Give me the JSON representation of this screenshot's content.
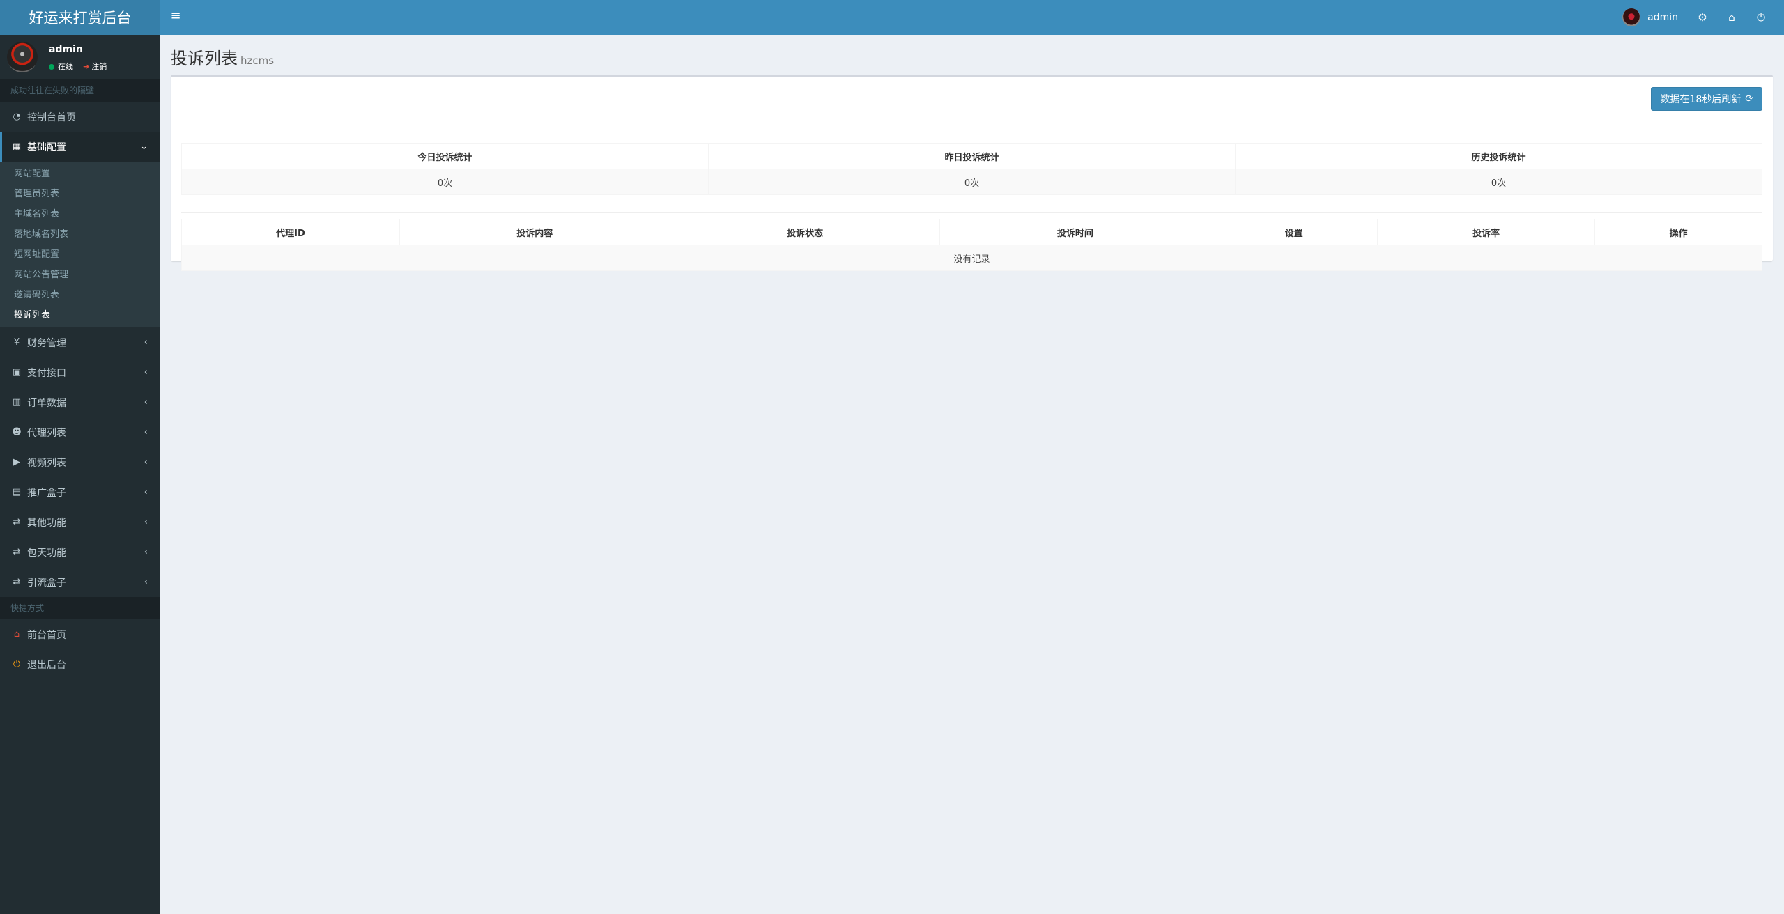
{
  "app": {
    "title": "好运来打赏后台"
  },
  "header": {
    "toggle_icon": "bars-icon",
    "user_name": "admin",
    "icons": [
      "gears-icon",
      "home-icon",
      "power-icon"
    ]
  },
  "sidebar": {
    "user": {
      "name": "admin",
      "online": "在线",
      "logout": "注销"
    },
    "motto": "成功往往在失败的隔壁",
    "items": [
      {
        "label": "控制台首页",
        "icon": "dashboard-icon"
      },
      {
        "label": "基础配置",
        "icon": "th-large-icon",
        "expanded": true
      },
      {
        "label": "财务管理",
        "icon": "yen-icon"
      },
      {
        "label": "支付接口",
        "icon": "square-icon"
      },
      {
        "label": "订单数据",
        "icon": "bar-chart-icon"
      },
      {
        "label": "代理列表",
        "icon": "users-icon"
      },
      {
        "label": "视频列表",
        "icon": "video-icon"
      },
      {
        "label": "推广盒子",
        "icon": "table-icon"
      },
      {
        "label": "其他功能",
        "icon": "retweet-icon"
      },
      {
        "label": "包天功能",
        "icon": "retweet-icon"
      },
      {
        "label": "引流盒子",
        "icon": "retweet-icon"
      }
    ],
    "submenu": [
      "网站配置",
      "管理员列表",
      "主域名列表",
      "落地域名列表",
      "短网址配置",
      "网站公告管理",
      "邀请码列表",
      "投诉列表"
    ],
    "quick_header": "快捷方式",
    "quick": [
      {
        "label": "前台首页",
        "icon": "home-icon",
        "color": "#dd4b39"
      },
      {
        "label": "退出后台",
        "icon": "power-icon",
        "color": "#f39c12"
      }
    ]
  },
  "main": {
    "title": "投诉列表",
    "subtitle": "hzcms",
    "refresh_label": "数据在18秒后刷新",
    "stats_headers": [
      "今日投诉统计",
      "昨日投诉统计",
      "历史投诉统计"
    ],
    "stats_values": [
      "0次",
      "0次",
      "0次"
    ],
    "list_headers": [
      "代理ID",
      "投诉内容",
      "投诉状态",
      "投诉时间",
      "设置",
      "投诉率",
      "操作"
    ],
    "empty_text": "没有记录"
  },
  "colors": {
    "accent": "#3c8dbc",
    "sidebar": "#222d32",
    "background": "#ecf0f5"
  }
}
